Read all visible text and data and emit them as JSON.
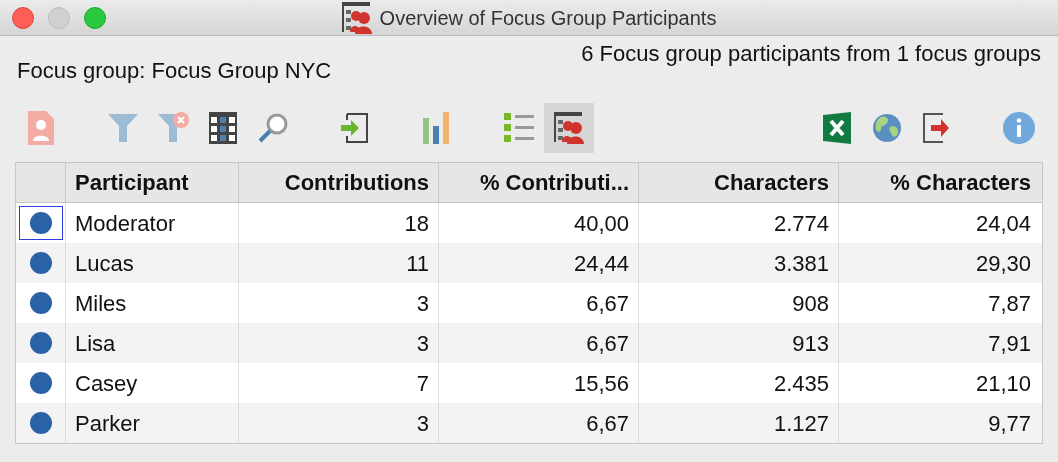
{
  "window": {
    "title": "Overview of Focus Group Participants"
  },
  "focus_group_label": "Focus group: Focus Group NYC",
  "summary": "6 Focus group participants from 1 focus groups",
  "toolbar_left": [
    {
      "kind": "person",
      "selected": false
    },
    {
      "kind": "gap"
    },
    {
      "kind": "filter",
      "selected": false
    },
    {
      "kind": "filter-remove",
      "selected": false
    },
    {
      "kind": "table",
      "selected": false
    },
    {
      "kind": "search",
      "selected": false
    },
    {
      "kind": "gap"
    },
    {
      "kind": "import",
      "selected": false
    },
    {
      "kind": "gap"
    },
    {
      "kind": "chart",
      "selected": false
    },
    {
      "kind": "gap"
    },
    {
      "kind": "list",
      "selected": false
    },
    {
      "kind": "overview",
      "selected": true
    }
  ],
  "toolbar_right": [
    {
      "kind": "excel"
    },
    {
      "kind": "globe"
    },
    {
      "kind": "export"
    },
    {
      "kind": "gap"
    },
    {
      "kind": "info"
    }
  ],
  "table": {
    "columns": [
      "Participant",
      "Contributions",
      "% Contributi...",
      "Characters",
      "% Characters"
    ],
    "rows": [
      {
        "focused": true,
        "cells": [
          "Moderator",
          "18",
          "40,00",
          "2.774",
          "24,04"
        ]
      },
      {
        "focused": false,
        "cells": [
          "Lucas",
          "11",
          "24,44",
          "3.381",
          "29,30"
        ]
      },
      {
        "focused": false,
        "cells": [
          "Miles",
          "3",
          "6,67",
          "908",
          "7,87"
        ]
      },
      {
        "focused": false,
        "cells": [
          "Lisa",
          "3",
          "6,67",
          "913",
          "7,91"
        ]
      },
      {
        "focused": false,
        "cells": [
          "Casey",
          "7",
          "15,56",
          "2.435",
          "21,10"
        ]
      },
      {
        "focused": false,
        "cells": [
          "Parker",
          "3",
          "6,67",
          "1.127",
          "9,77"
        ]
      }
    ]
  }
}
